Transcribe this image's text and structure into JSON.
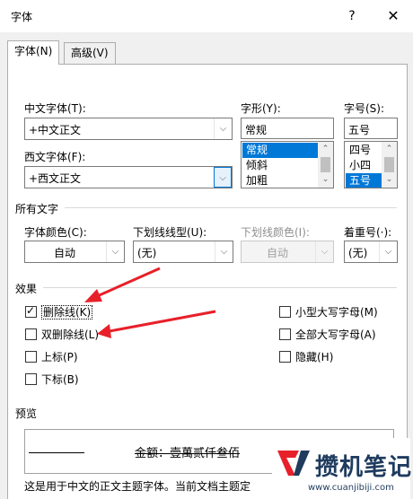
{
  "window": {
    "title": "字体",
    "help_label": "?",
    "close_label": "✕"
  },
  "tabs": [
    {
      "label": "字体(N)",
      "active": true
    },
    {
      "label": "高级(V)",
      "active": false
    }
  ],
  "chinese_font": {
    "label": "中文字体(T):",
    "value": "+中文正文"
  },
  "western_font": {
    "label": "西文字体(F):",
    "value": "+西文正文"
  },
  "font_style": {
    "label": "字形(Y):",
    "value": "常规",
    "options": [
      "常规",
      "倾斜",
      "加粗"
    ],
    "selected": "常规"
  },
  "font_size": {
    "label": "字号(S):",
    "value": "五号",
    "options": [
      "四号",
      "小四",
      "五号"
    ],
    "selected": "五号"
  },
  "all_text": {
    "heading": "所有文字",
    "font_color": {
      "label": "字体颜色(C):",
      "value": "自动"
    },
    "underline_type": {
      "label": "下划线线型(U):",
      "value": "(无)"
    },
    "underline_color": {
      "label": "下划线颜色(I):",
      "value": "自动"
    },
    "emphasis_mark": {
      "label": "着重号(·):",
      "value": "(无)"
    }
  },
  "effects": {
    "heading": "效果",
    "left": [
      {
        "label": "删除线(K)",
        "checked": true
      },
      {
        "label": "双删除线(L)",
        "checked": false
      },
      {
        "label": "上标(P)",
        "checked": false
      },
      {
        "label": "下标(B)",
        "checked": false
      }
    ],
    "right": [
      {
        "label": "小型大写字母(M)",
        "checked": false
      },
      {
        "label": "全部大写字母(A)",
        "checked": false
      },
      {
        "label": "隐藏(H)",
        "checked": false
      }
    ]
  },
  "preview": {
    "heading": "预览",
    "sample": "金额：壹萬贰仟叁佰",
    "description": "这是用于中文的正文主题字体。当前文档主题定"
  },
  "watermark": {
    "text": "攒机笔记",
    "url": "www.cuanjibiji.com"
  },
  "colors": {
    "accent": "#0078d7",
    "annotation_arrow": "#e8202a"
  },
  "icons": {
    "dropdown": "chevron-down-icon",
    "scroll_up": "chevron-up-icon"
  }
}
